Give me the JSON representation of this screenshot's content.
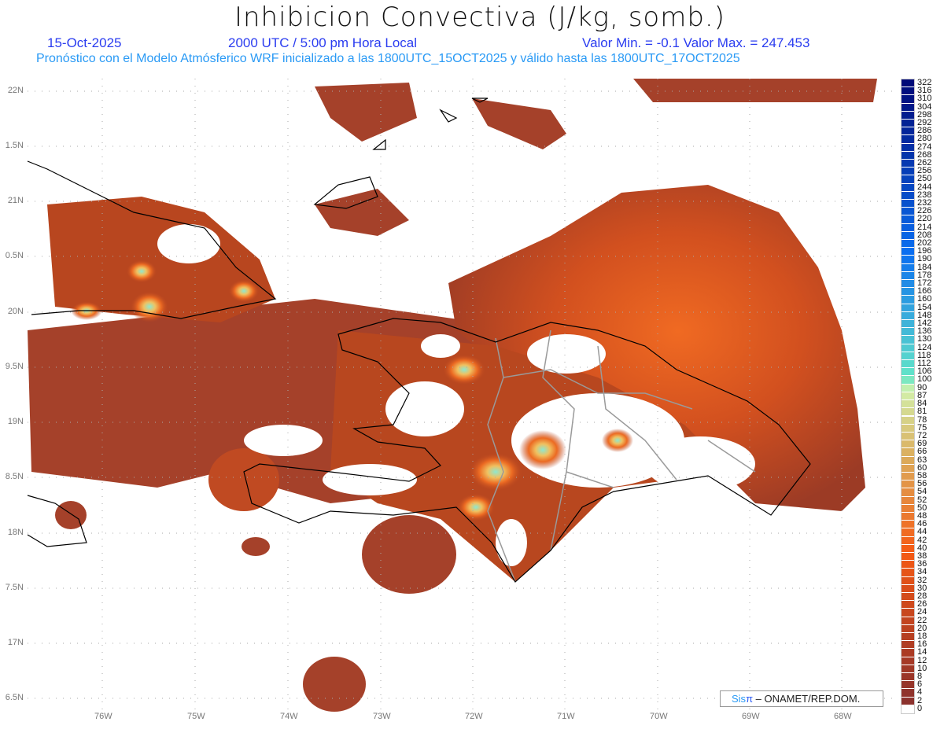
{
  "title": "Inhibicion Convectiva (J/kg, somb.)",
  "date": "15-Oct-2025",
  "time": "2000 UTC / 5:00 pm Hora Local",
  "minmax": "Valor Min. = -0.1  Valor Max. = 247.453",
  "description": "Pronóstico con el Modelo Atmósferico WRF inicializado a las 1800UTC_15OCT2025 y válido hasta las  1800UTC_17OCT2025",
  "lat_labels": [
    "22N",
    "1.5N",
    "21N",
    "0.5N",
    "20N",
    "9.5N",
    "19N",
    "8.5N",
    "18N",
    "7.5N",
    "17N",
    "6.5N"
  ],
  "lon_labels": [
    "76W",
    "75W",
    "74W",
    "73W",
    "72W",
    "71W",
    "70W",
    "69W",
    "68W"
  ],
  "colorbar": {
    "labels": [
      "322",
      "316",
      "310",
      "304",
      "298",
      "292",
      "286",
      "280",
      "274",
      "268",
      "262",
      "256",
      "250",
      "244",
      "238",
      "232",
      "226",
      "220",
      "214",
      "208",
      "202",
      "196",
      "190",
      "184",
      "178",
      "172",
      "166",
      "160",
      "154",
      "148",
      "142",
      "136",
      "130",
      "124",
      "118",
      "112",
      "106",
      "100",
      "90",
      "87",
      "84",
      "81",
      "78",
      "75",
      "72",
      "69",
      "66",
      "63",
      "60",
      "58",
      "56",
      "54",
      "52",
      "50",
      "48",
      "46",
      "44",
      "42",
      "40",
      "38",
      "36",
      "34",
      "32",
      "30",
      "28",
      "26",
      "24",
      "22",
      "20",
      "18",
      "16",
      "14",
      "12",
      "10",
      "8",
      "6",
      "4",
      "2",
      "0"
    ]
  },
  "logo": {
    "brand": "Sis",
    "pi": "π",
    "credit": "– ONAMET/REP.DOM."
  }
}
